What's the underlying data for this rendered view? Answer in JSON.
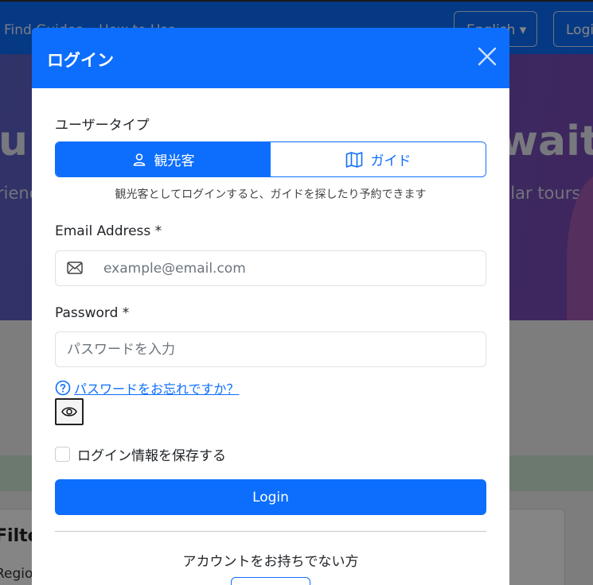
{
  "background": {
    "nav_links": [
      "Find Guides",
      "How to Use"
    ],
    "language": "English",
    "login": "Login",
    "hero_title_left": "u",
    "hero_title_right": "waits",
    "hero_sub_left": "riend",
    "hero_sub_right": "ular tours",
    "filter_heading": "Filte",
    "filter_region": "Regio"
  },
  "modal": {
    "title": "ログイン",
    "user_type_label": "ユーザータイプ",
    "user_types": [
      {
        "label": "観光客",
        "icon": "person-icon",
        "active": true
      },
      {
        "label": "ガイド",
        "icon": "map-icon",
        "active": false
      }
    ],
    "user_type_hint": "観光客としてログインすると、ガイドを探したり予約できます",
    "email": {
      "label": "Email Address *",
      "placeholder": "example@email.com",
      "value": ""
    },
    "password": {
      "label": "Password *",
      "placeholder": "パスワードを入力",
      "value": ""
    },
    "forgot_password": "パスワードをお忘れですか？",
    "remember_me": "ログイン情報を保存する",
    "login_button": "Login",
    "no_account": "アカウントをお持ちでない方"
  },
  "colors": {
    "primary": "#0d6efd",
    "text": "#212529",
    "hero": "#6a55bd"
  }
}
